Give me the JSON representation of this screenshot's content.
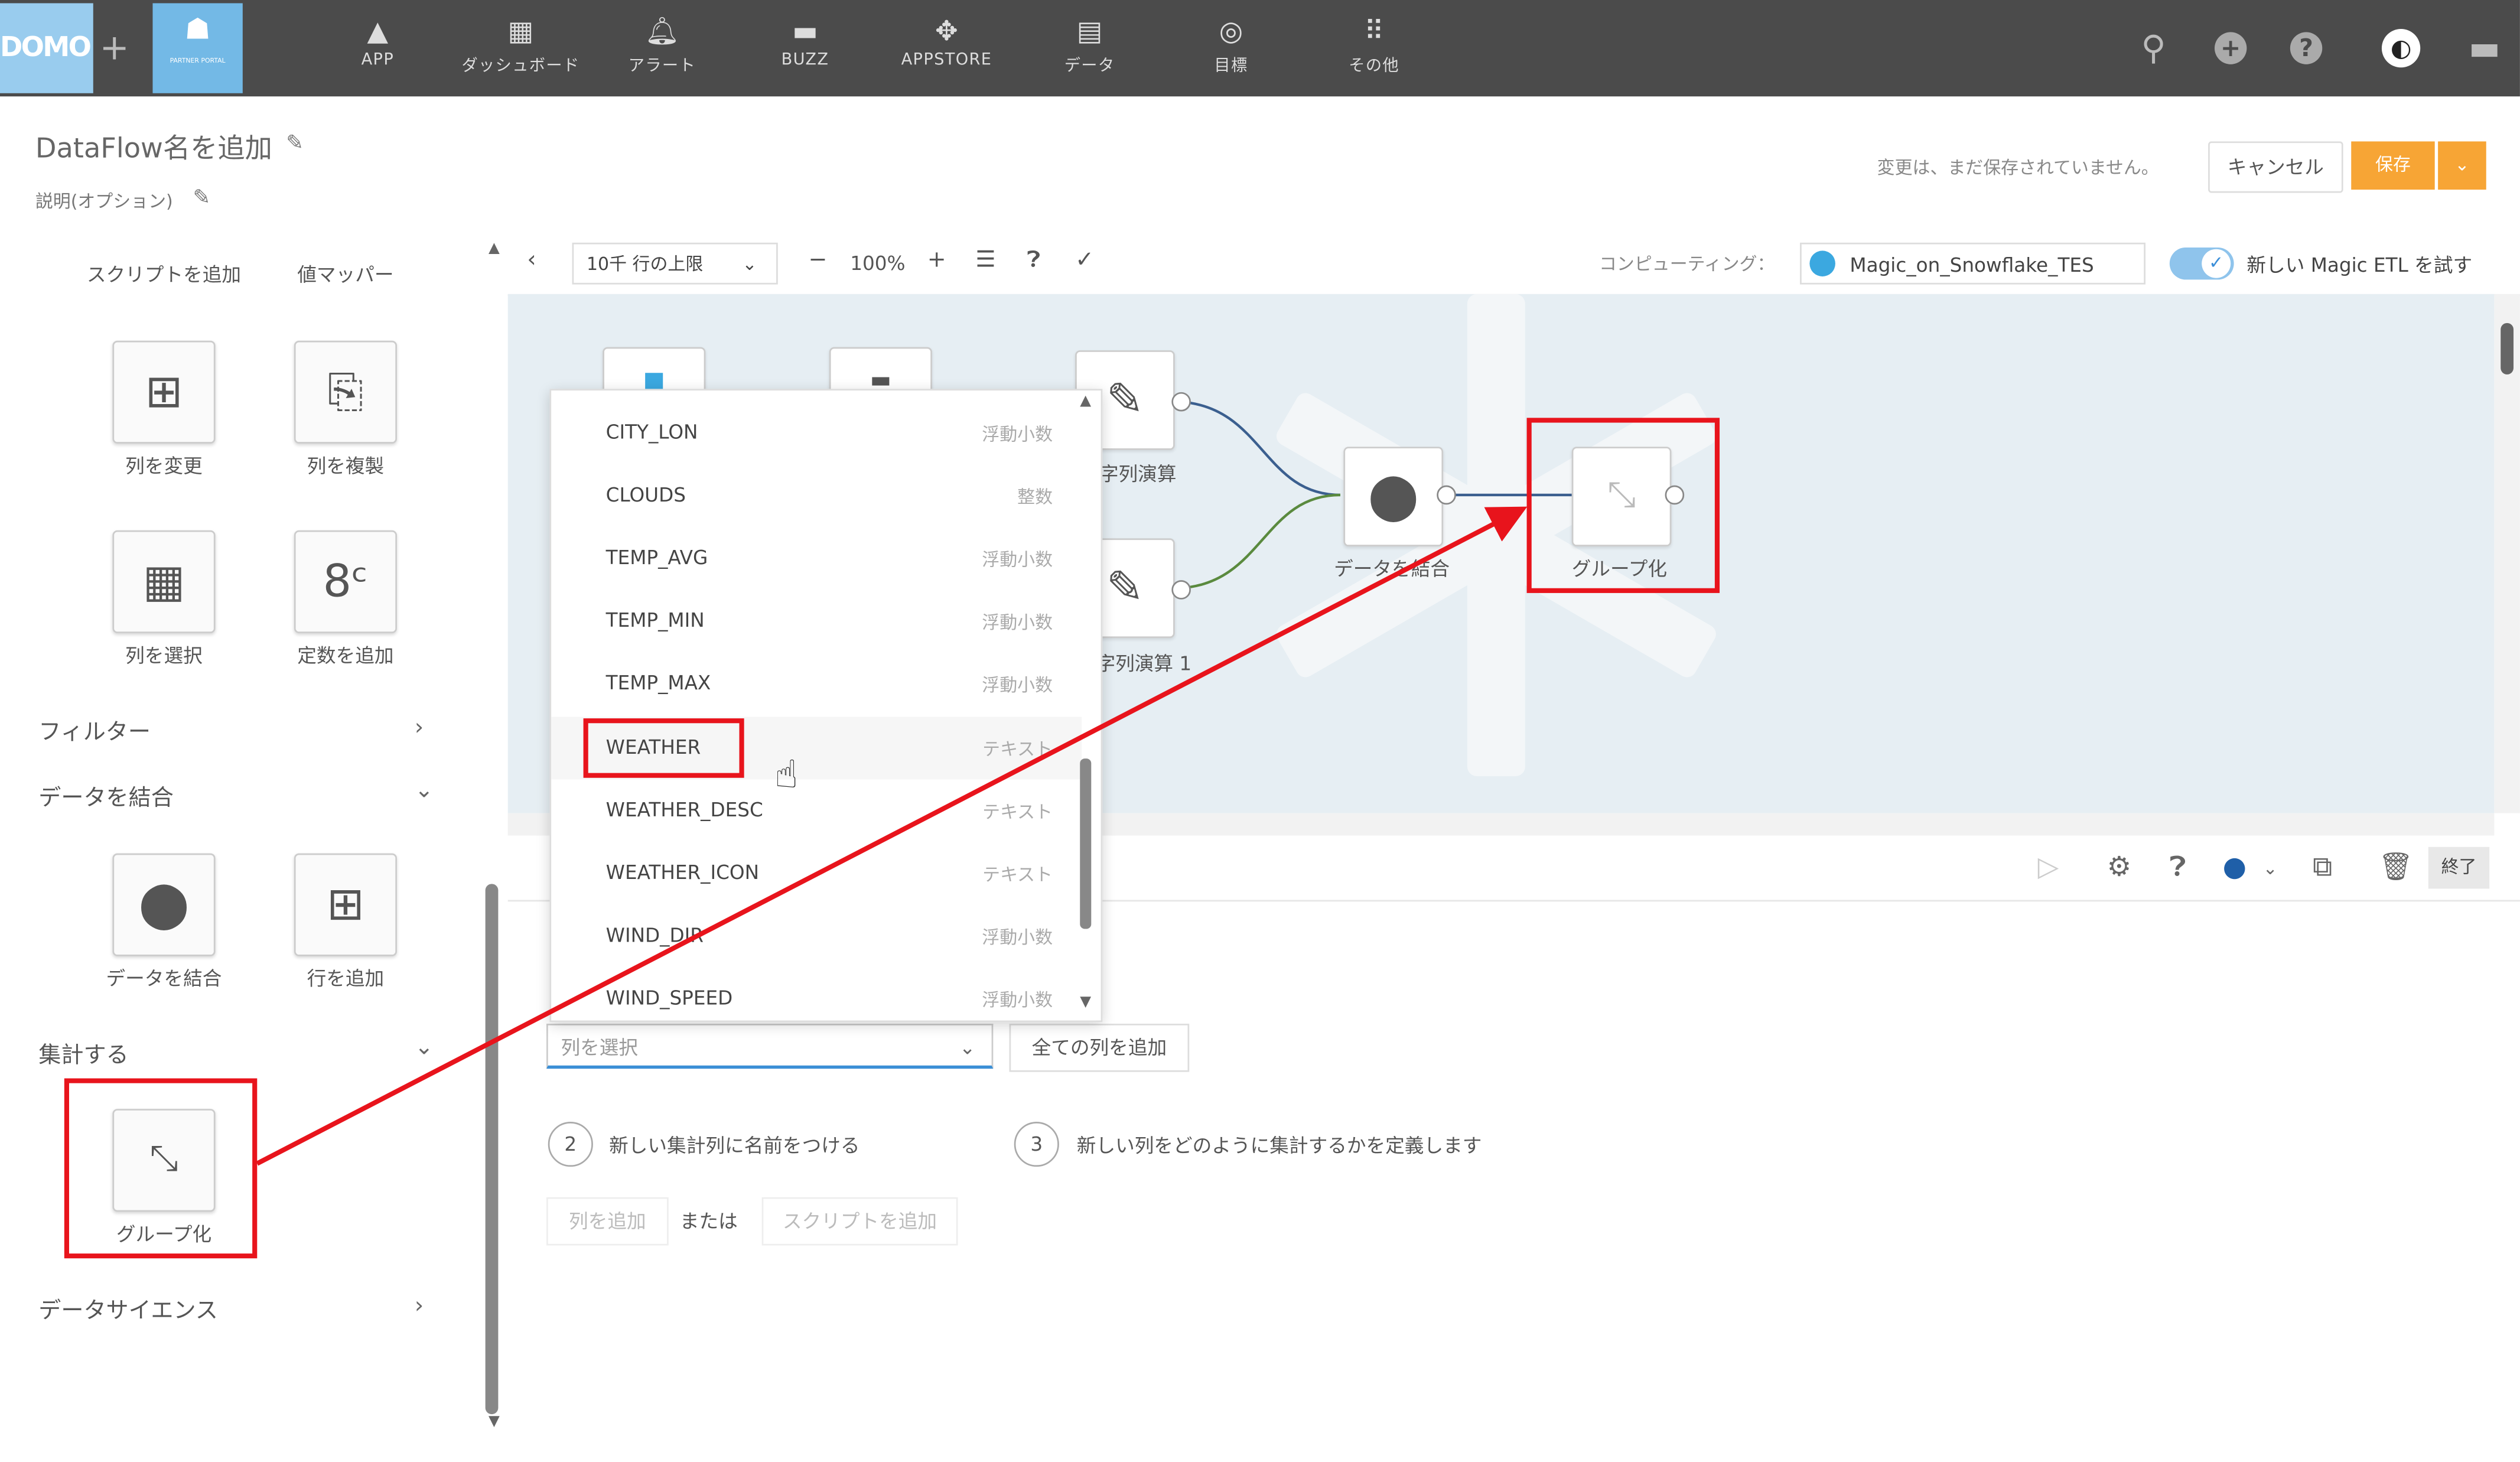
{
  "topbar": {
    "logo": "DOMO",
    "partner_text": "PARTNER PORTAL",
    "nav": [
      {
        "label": "APP",
        "icon": "rocket-icon"
      },
      {
        "label": "ダッシュボード",
        "icon": "dashboard-icon"
      },
      {
        "label": "アラート",
        "icon": "bell-icon"
      },
      {
        "label": "BUZZ",
        "icon": "chat-icon"
      },
      {
        "label": "APPSTORE",
        "icon": "appstore-icon"
      },
      {
        "label": "データ",
        "icon": "database-icon"
      },
      {
        "label": "目標",
        "icon": "target-icon"
      },
      {
        "label": "その他",
        "icon": "grid-icon"
      }
    ]
  },
  "header": {
    "title": "DataFlow名を追加",
    "description": "説明(オプション)",
    "unsaved": "変更は、まだ保存されていません。",
    "cancel": "キャンセル",
    "save": "保存"
  },
  "sidebar": {
    "top_labels": [
      "スクリプトを追加",
      "値マッパー"
    ],
    "tiles_row1": [
      "列を変更",
      "列を複製"
    ],
    "tiles_row2": [
      "列を選択",
      "定数を追加"
    ],
    "section_filter": "フィルター",
    "section_join": "データを結合",
    "tiles_join": [
      "データを結合",
      "行を追加"
    ],
    "section_aggregate": "集計する",
    "tile_group": "グループ化",
    "section_datascience": "データサイエンス"
  },
  "toolbar": {
    "row_limit": "10千 行の上限",
    "zoom": "100%",
    "computing_label": "コンピューティング：",
    "computing_value": "Magic_on_Snowflake_TES",
    "toggle_label": "新しい Magic ETL を試す"
  },
  "canvas": {
    "node_calc1": "字列演算",
    "node_calc2": "字列演算 1",
    "node_join": "データを結合",
    "node_group": "グループ化"
  },
  "dropdown": {
    "rows": [
      {
        "name": "CITY_LON",
        "type": "浮動小数"
      },
      {
        "name": "CLOUDS",
        "type": "整数"
      },
      {
        "name": "TEMP_AVG",
        "type": "浮動小数"
      },
      {
        "name": "TEMP_MIN",
        "type": "浮動小数"
      },
      {
        "name": "TEMP_MAX",
        "type": "浮動小数"
      },
      {
        "name": "WEATHER",
        "type": "テキスト"
      },
      {
        "name": "WEATHER_DESC",
        "type": "テキスト"
      },
      {
        "name": "WEATHER_ICON",
        "type": "テキスト"
      },
      {
        "name": "WIND_DIR",
        "type": "浮動小数"
      },
      {
        "name": "WIND_SPEED",
        "type": "浮動小数"
      }
    ],
    "highlighted": "WEATHER"
  },
  "panel": {
    "column_select_placeholder": "列を選択",
    "add_all_columns": "全ての列を追加",
    "step2_num": "2",
    "step2_text": "新しい集計列に名前をつける",
    "step3_num": "3",
    "step3_text": "新しい列をどのように集計するかを定義します",
    "add_column": "列を追加",
    "or": "または",
    "add_script": "スクリプトを追加",
    "end": "終了"
  },
  "colors": {
    "annotation_red": "#e8141c",
    "save_orange": "#f7a535",
    "topbar": "#4b4b4b"
  }
}
